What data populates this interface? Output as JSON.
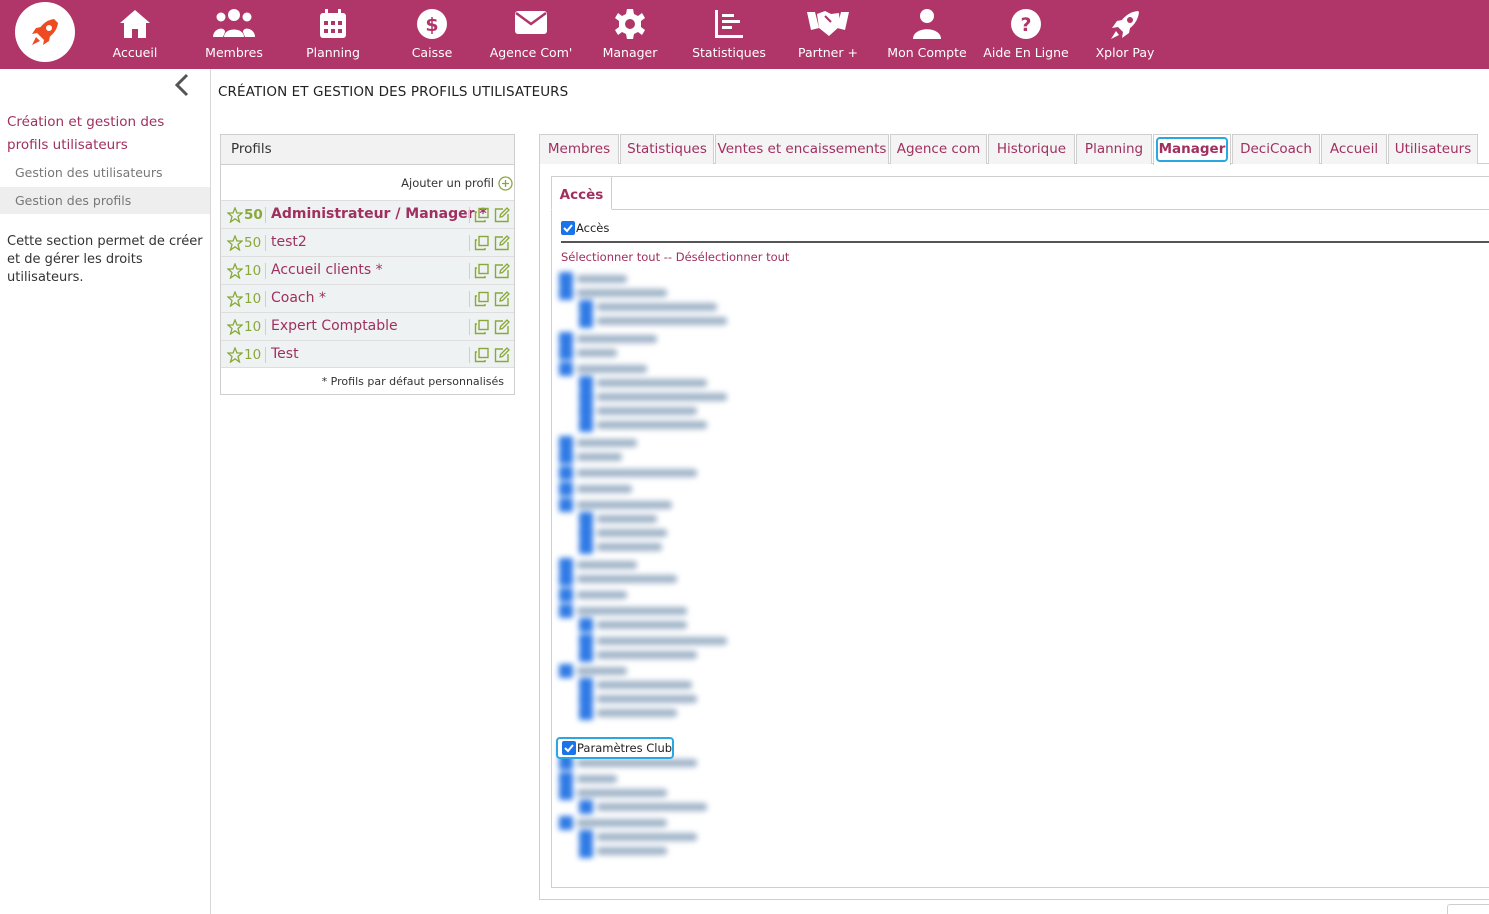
{
  "colors": {
    "brand": "#b03569",
    "accent_text": "#a0305f",
    "level_green": "#8aa83a",
    "focus_ring": "#2aa7e0",
    "checkbox_blue": "#1a73e8"
  },
  "nav": {
    "items": [
      {
        "label": "Accueil",
        "icon": "home-icon"
      },
      {
        "label": "Membres",
        "icon": "users-icon"
      },
      {
        "label": "Planning",
        "icon": "calendar-icon"
      },
      {
        "label": "Caisse",
        "icon": "dollar-icon"
      },
      {
        "label": "Agence Com'",
        "icon": "envelope-icon"
      },
      {
        "label": "Manager",
        "icon": "gear-icon"
      },
      {
        "label": "Statistiques",
        "icon": "chart-icon"
      },
      {
        "label": "Partner +",
        "icon": "handshake-icon"
      },
      {
        "label": "Mon Compte",
        "icon": "user-icon"
      },
      {
        "label": "Aide En Ligne",
        "icon": "help-icon"
      },
      {
        "label": "Xplor Pay",
        "icon": "rocket-icon"
      }
    ]
  },
  "sidebar": {
    "title": "Création et gestion des profils utilisateurs",
    "links": [
      {
        "label": "Gestion des utilisateurs",
        "active": false
      },
      {
        "label": "Gestion des profils",
        "active": true
      }
    ],
    "description": "Cette section permet de créer et de gérer les droits utilisateurs."
  },
  "page": {
    "title": "CRÉATION ET GESTION DES PROFILS UTILISATEURS"
  },
  "profiles": {
    "header": "Profils",
    "add_label": "Ajouter un profil",
    "rows": [
      {
        "level": "50",
        "name": "Administrateur / Manager *",
        "bold": true
      },
      {
        "level": "50",
        "name": "test2",
        "bold": false
      },
      {
        "level": "10",
        "name": "Accueil clients *",
        "bold": false
      },
      {
        "level": "10",
        "name": "Coach *",
        "bold": false
      },
      {
        "level": "10",
        "name": "Expert Comptable",
        "bold": false
      },
      {
        "level": "10",
        "name": "Test",
        "bold": false
      }
    ],
    "footnote": "* Profils par défaut personnalisés"
  },
  "tabs": {
    "items": [
      {
        "label": "Membres"
      },
      {
        "label": "Statistiques"
      },
      {
        "label": "Ventes et encaissements"
      },
      {
        "label": "Agence com"
      },
      {
        "label": "Historique"
      },
      {
        "label": "Planning"
      },
      {
        "label": "Manager",
        "active": true
      },
      {
        "label": "DeciCoach"
      },
      {
        "label": "Accueil"
      },
      {
        "label": "Utilisateurs"
      }
    ]
  },
  "permissions": {
    "subtab": "Accès",
    "access_label": "Accès",
    "access_checked": true,
    "select_all": "Sélectionner tout",
    "select_sep": "--",
    "deselect_all": "Désélectionner tout",
    "param_label": "Paramètres Club",
    "param_checked": true
  }
}
